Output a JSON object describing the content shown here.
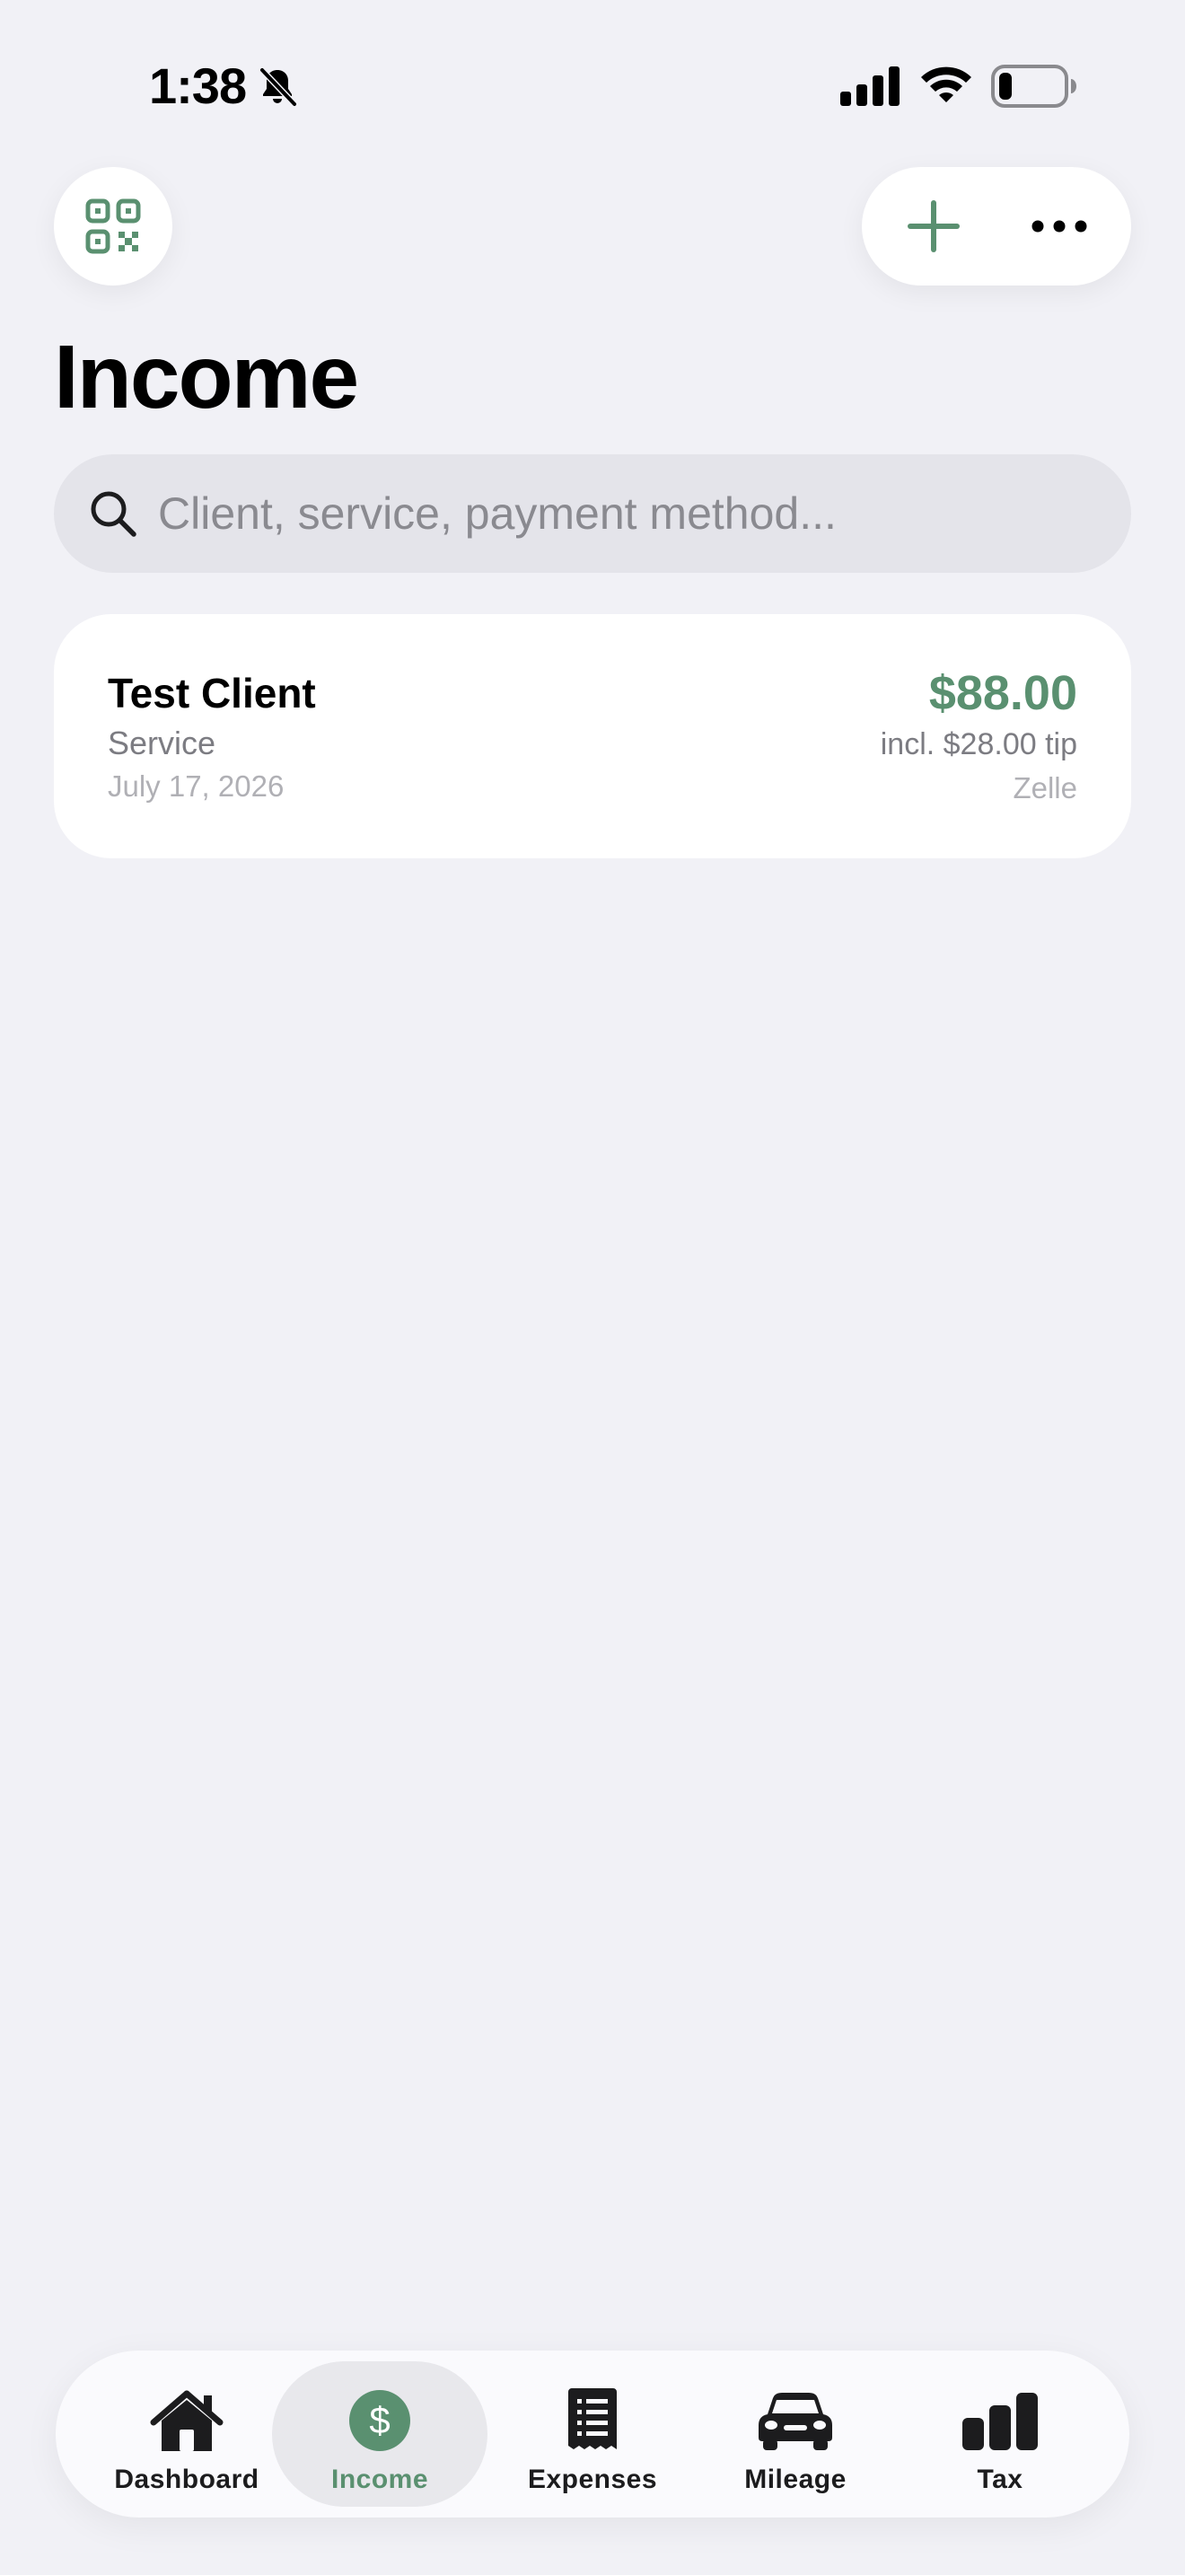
{
  "status_bar": {
    "time": "1:38"
  },
  "header": {
    "title": "Income"
  },
  "search": {
    "placeholder": "Client, service, payment method..."
  },
  "income_entries": [
    {
      "client": "Test Client",
      "service": "Service",
      "date": "July 17, 2026",
      "amount": "$88.00",
      "tip_note": "incl. $28.00 tip",
      "payment_method": "Zelle"
    }
  ],
  "tab_bar": {
    "items": [
      {
        "label": "Dashboard",
        "icon": "house-icon",
        "active": false
      },
      {
        "label": "Income",
        "icon": "dollar-circle-icon",
        "active": true
      },
      {
        "label": "Expenses",
        "icon": "receipt-icon",
        "active": false
      },
      {
        "label": "Mileage",
        "icon": "car-icon",
        "active": false
      },
      {
        "label": "Tax",
        "icon": "bar-chart-icon",
        "active": false
      }
    ]
  },
  "colors": {
    "accent": "#5a9070",
    "background": "#f1f1f6",
    "card": "#ffffff",
    "search_fill": "#e4e4ea"
  }
}
